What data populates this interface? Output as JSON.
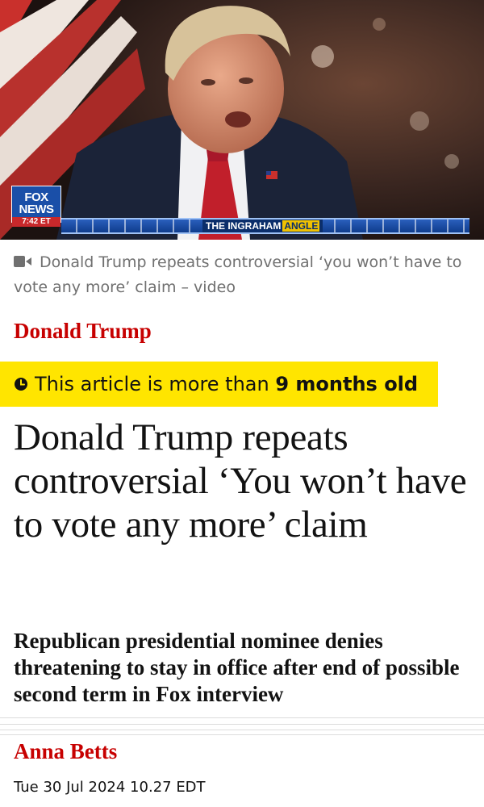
{
  "hero": {
    "logo_text": [
      "FOX",
      "NEWS"
    ],
    "logo_time": "7:42 ET",
    "chyron": {
      "title": "THE INGRAHAM",
      "title_highlight": "ANGLE"
    },
    "icon": "video-still"
  },
  "caption": {
    "icon": "video-icon",
    "text": "Donald Trump repeats controversial ‘you won’t have to vote any more’ claim – video"
  },
  "section_label": "Donald Trump",
  "age_warning": {
    "icon": "clock-icon",
    "prefix": "This article is more than ",
    "highlight": "9 months old"
  },
  "headline": "Donald Trump repeats controversial ‘You won’t have to vote any more’ claim",
  "standfirst": "Republican presidential nominee denies threatening to stay in office after end of possible second term in Fox interview",
  "byline": "Anna Betts",
  "dateline": "Tue 30 Jul 2024 10.27 EDT",
  "colors": {
    "brand_red": "#c70000",
    "warning_yellow": "#ffe500",
    "text": "#121212",
    "muted": "#707070"
  }
}
